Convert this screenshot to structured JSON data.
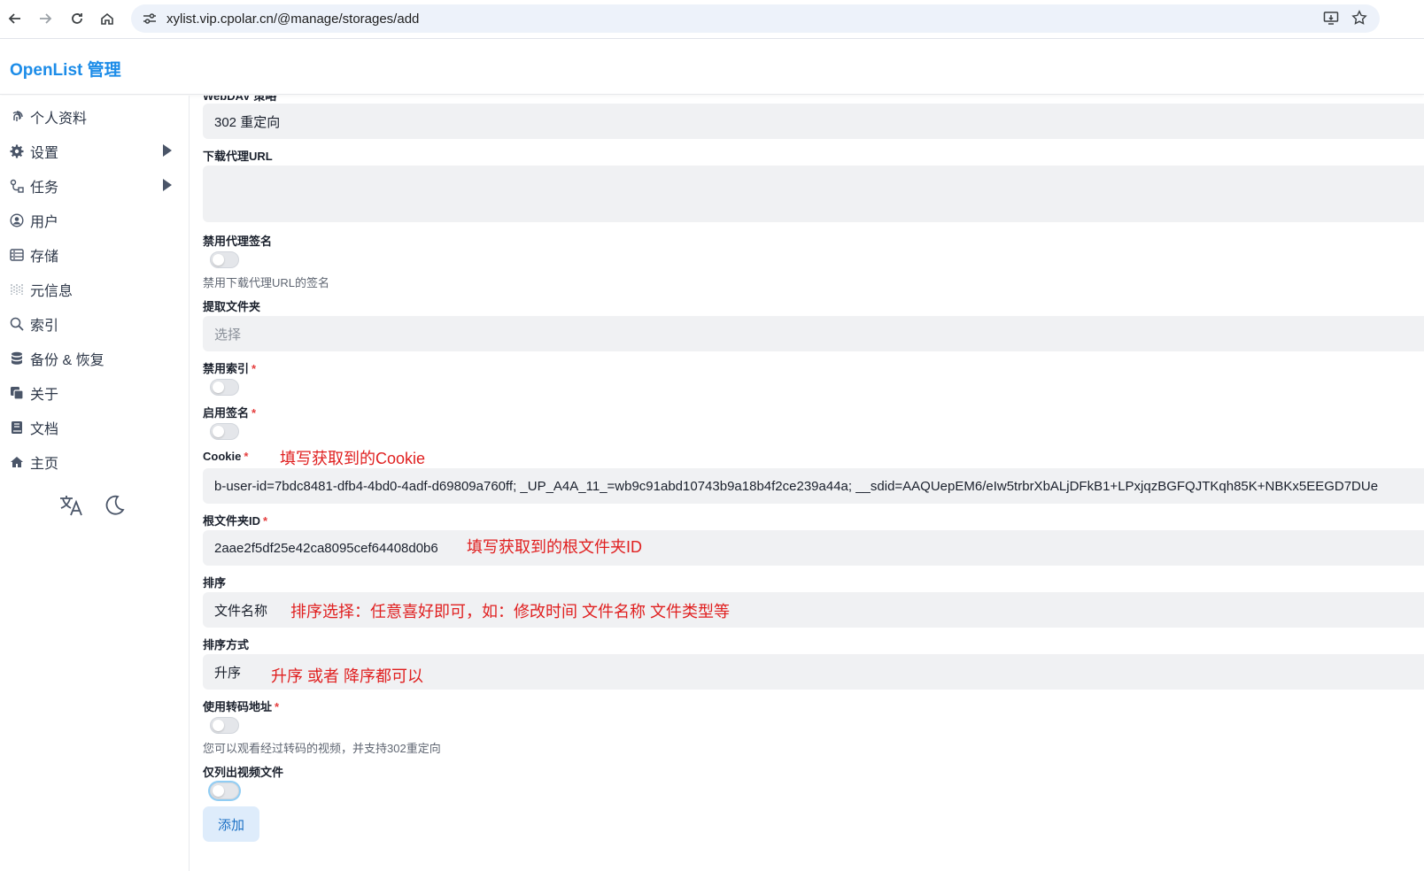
{
  "browser": {
    "url": "xylist.vip.cpolar.cn/@manage/storages/add"
  },
  "app": {
    "title": "OpenList 管理"
  },
  "sidebar": {
    "items": [
      {
        "label": "个人资料",
        "icon": "fingerprint-icon"
      },
      {
        "label": "设置",
        "icon": "gear-icon"
      },
      {
        "label": "任务",
        "icon": "task-icon"
      },
      {
        "label": "用户",
        "icon": "user-icon"
      },
      {
        "label": "存储",
        "icon": "storage-icon"
      },
      {
        "label": "元信息",
        "icon": "meta-icon"
      },
      {
        "label": "索引",
        "icon": "search-icon"
      },
      {
        "label": "备份 & 恢复",
        "icon": "database-icon"
      },
      {
        "label": "关于",
        "icon": "copy-icon"
      },
      {
        "label": "文档",
        "icon": "book-icon"
      },
      {
        "label": "主页",
        "icon": "home-icon"
      }
    ]
  },
  "form": {
    "webdav_policy_label": "WebDAV 策略",
    "webdav_policy_value": "302 重定向",
    "download_proxy_url_label": "下载代理URL",
    "download_proxy_url_value": "",
    "disable_proxy_sign_label": "禁用代理签名",
    "disable_proxy_sign_help": "禁用下载代理URL的签名",
    "extract_folder_label": "提取文件夹",
    "extract_folder_placeholder": "选择",
    "disable_index_label": "禁用索引",
    "enable_sign_label": "启用签名",
    "cookie_label": "Cookie",
    "cookie_value": "b-user-id=7bdc8481-dfb4-4bd0-4adf-d69809a760ff; _UP_A4A_11_=wb9c91abd10743b9a18b4f2ce239a44a; __sdid=AAQUepEM6/eIw5trbrXbALjDFkB1+LPxjqzBGFQJTKqh85K+NBKx5EEGD7DUe",
    "root_folder_id_label": "根文件夹ID",
    "root_folder_id_value": "2aae2f5df25e42ca8095cef64408d0b6",
    "order_by_label": "排序",
    "order_by_value": "文件名称",
    "order_direction_label": "排序方式",
    "order_direction_value": "升序",
    "use_transcode_label": "使用转码地址",
    "use_transcode_help": "您可以观看经过转码的视频，并支持302重定向",
    "only_video_label": "仅列出视频文件",
    "required_mark": "*",
    "add_button": "添加"
  },
  "annotations": {
    "cookie_note": "填写获取到的Cookie",
    "root_id_note": "填写获取到的根文件夹ID",
    "order_note": "排序选择：任意喜好即可，如：修改时间  文件名称 文件类型等",
    "direction_note": "升序 或者 降序都可以"
  }
}
